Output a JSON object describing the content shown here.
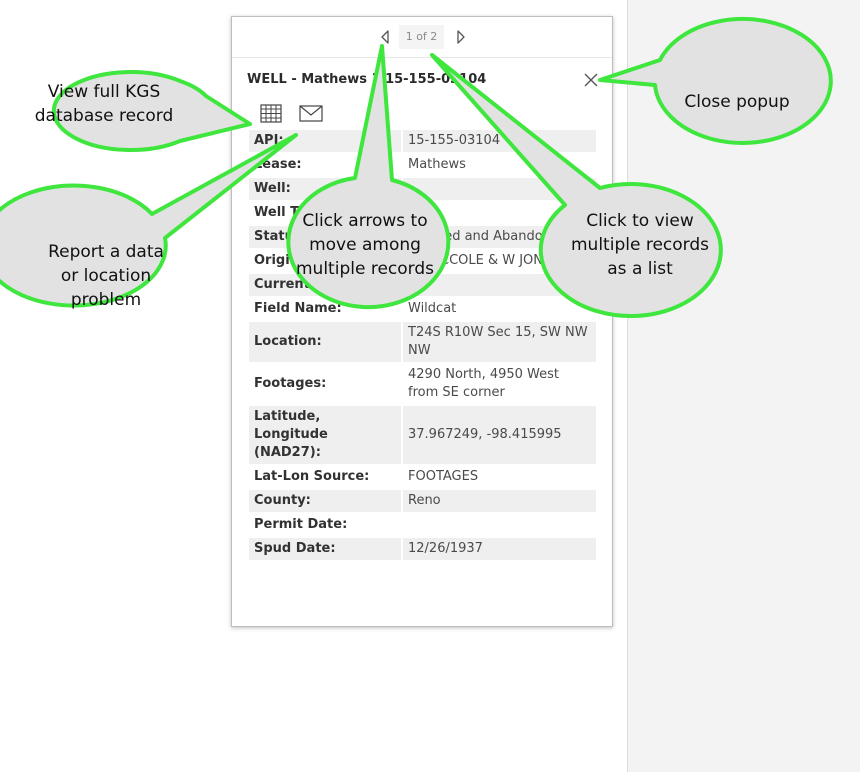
{
  "pager": {
    "count": "1 of 2"
  },
  "popup": {
    "title": "WELL - Mathews 1  15-155-03104"
  },
  "icons": {
    "prev": "chevron-left-icon",
    "next": "chevron-right-icon",
    "close": "close-icon",
    "table": "table-icon",
    "mail": "mail-icon"
  },
  "rows": [
    {
      "label": "API:",
      "value": "15-155-03104"
    },
    {
      "label": "Lease:",
      "value": "Mathews"
    },
    {
      "label": "Well:",
      "value": ""
    },
    {
      "label": "Well Type:",
      "value": ""
    },
    {
      "label": "Status:",
      "value": "Plugged and Abandoned"
    },
    {
      "label": "Original Operator:",
      "value": "J E PICCOLE & W JONES OIL"
    },
    {
      "label": "Current Operator:",
      "value": ""
    },
    {
      "label": "Field Name:",
      "value": "Wildcat"
    },
    {
      "label": "Location:",
      "value": "T24S R10W Sec 15, SW NW NW"
    },
    {
      "label": "Footages:",
      "value": "4290 North, 4950 West from SE corner"
    },
    {
      "label": "Latitude, Longitude (NAD27):",
      "value": "37.967249,  -98.415995"
    },
    {
      "label": "Lat-Lon Source:",
      "value": "FOOTAGES"
    },
    {
      "label": "County:",
      "value": "Reno"
    },
    {
      "label": "Permit Date:",
      "value": ""
    },
    {
      "label": "Spud Date:",
      "value": "12/26/1937"
    }
  ],
  "callouts": {
    "view_full": [
      "View full KGS",
      "database record"
    ],
    "report": [
      "Report a data",
      "or location",
      "problem"
    ],
    "arrows": [
      "Click arrows to",
      "move among",
      "multiple records"
    ],
    "list": [
      "Click to view",
      "multiple records",
      "as a list"
    ],
    "close": [
      "Close popup"
    ]
  },
  "colors": {
    "callout_fill": "#e2e2e2",
    "callout_stroke": "#3ee63e",
    "panel": "#f3f3f3"
  }
}
